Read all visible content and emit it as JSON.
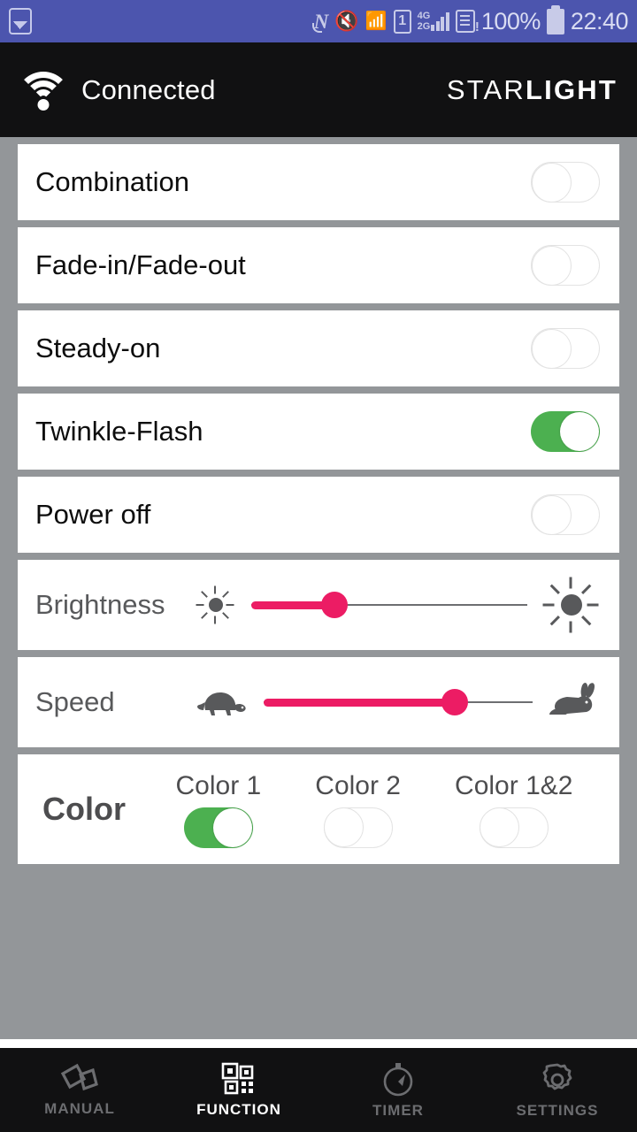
{
  "status_bar": {
    "notification_icon": "gallery-icon",
    "icons": [
      "nfc-icon",
      "vibrate-mute-icon",
      "wifi-icon",
      "sim1-icon",
      "signal-4g-2g-icon",
      "sim-card-alert-icon"
    ],
    "battery_percent": "100%",
    "battery_icon": "battery-full-icon",
    "time": "22:40",
    "background_color": "#4c55ae"
  },
  "app_bar": {
    "wifi_icon": "wifi-icon",
    "connection_status": "Connected",
    "logo_first": "STAR",
    "logo_second": "LIGHT",
    "background_color": "#111112"
  },
  "modes": [
    {
      "label": "Combination",
      "state": "off"
    },
    {
      "label": "Fade-in/Fade-out",
      "state": "off"
    },
    {
      "label": "Steady-on",
      "state": "off"
    },
    {
      "label": "Twinkle-Flash",
      "state": "on"
    },
    {
      "label": "Power off",
      "state": "off"
    }
  ],
  "sliders": [
    {
      "label": "Brightness",
      "left_icon": "sun-small-icon",
      "right_icon": "sun-large-icon",
      "value_percent": 30
    },
    {
      "label": "Speed",
      "left_icon": "turtle-icon",
      "right_icon": "rabbit-icon",
      "value_percent": 71
    }
  ],
  "color_section": {
    "title": "Color",
    "options": [
      {
        "label": "Color 1",
        "state": "on"
      },
      {
        "label": "Color 2",
        "state": "off"
      },
      {
        "label": "Color 1&2",
        "state": "off"
      }
    ]
  },
  "bottom_nav": [
    {
      "label": "MANUAL",
      "icon": "cards-icon",
      "active": false
    },
    {
      "label": "FUNCTION",
      "icon": "qr-grid-icon",
      "active": true
    },
    {
      "label": "TIMER",
      "icon": "stopwatch-icon",
      "active": false
    },
    {
      "label": "SETTINGS",
      "icon": "gear-icon",
      "active": false
    }
  ],
  "colors": {
    "accent_on": "#4cb050",
    "slider_accent": "#ec1c64",
    "page_background": "#939699",
    "dark_bar": "#111112",
    "status_bar": "#4c55ae"
  }
}
